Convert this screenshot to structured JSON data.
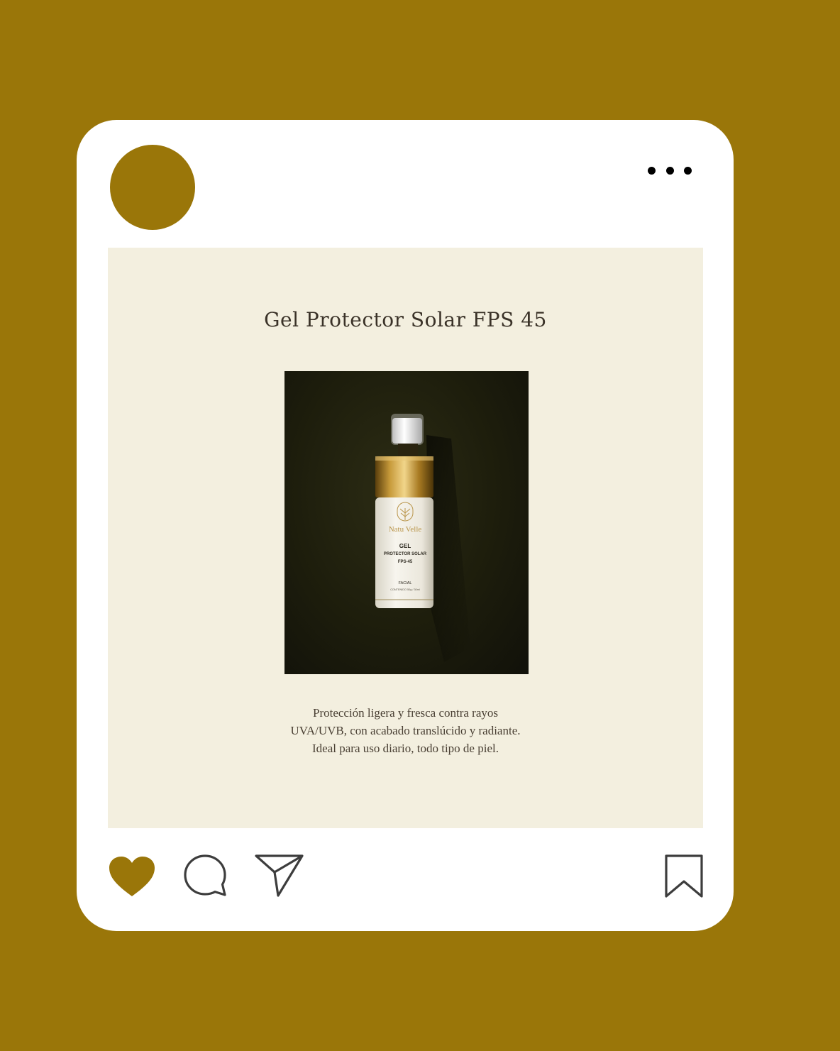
{
  "colors": {
    "background": "#9a7609",
    "card": "#ffffff",
    "post_background": "#f3efdf",
    "accent": "#9a7609",
    "photo_background": "#1b1b0b"
  },
  "header": {
    "avatar_icon": "avatar-circle",
    "menu_icon": "more-horizontal-icon"
  },
  "post": {
    "title": "Gel Protector Solar FPS 45",
    "product": {
      "brand": "Natu Velle",
      "line1": "GEL",
      "line2": "PROTECTOR SOLAR",
      "line3": "FPS-45",
      "type": "FACIAL",
      "content": "CONTENIDO 50g / 30ml"
    },
    "caption_lines": [
      "Protección ligera y fresca contra rayos",
      "UVA/UVB, con acabado translúcido y radiante.",
      "Ideal para uso diario, todo tipo de piel."
    ]
  },
  "actions": {
    "like_icon": "heart-icon",
    "comment_icon": "comment-icon",
    "share_icon": "send-icon",
    "save_icon": "bookmark-icon",
    "liked": true
  }
}
